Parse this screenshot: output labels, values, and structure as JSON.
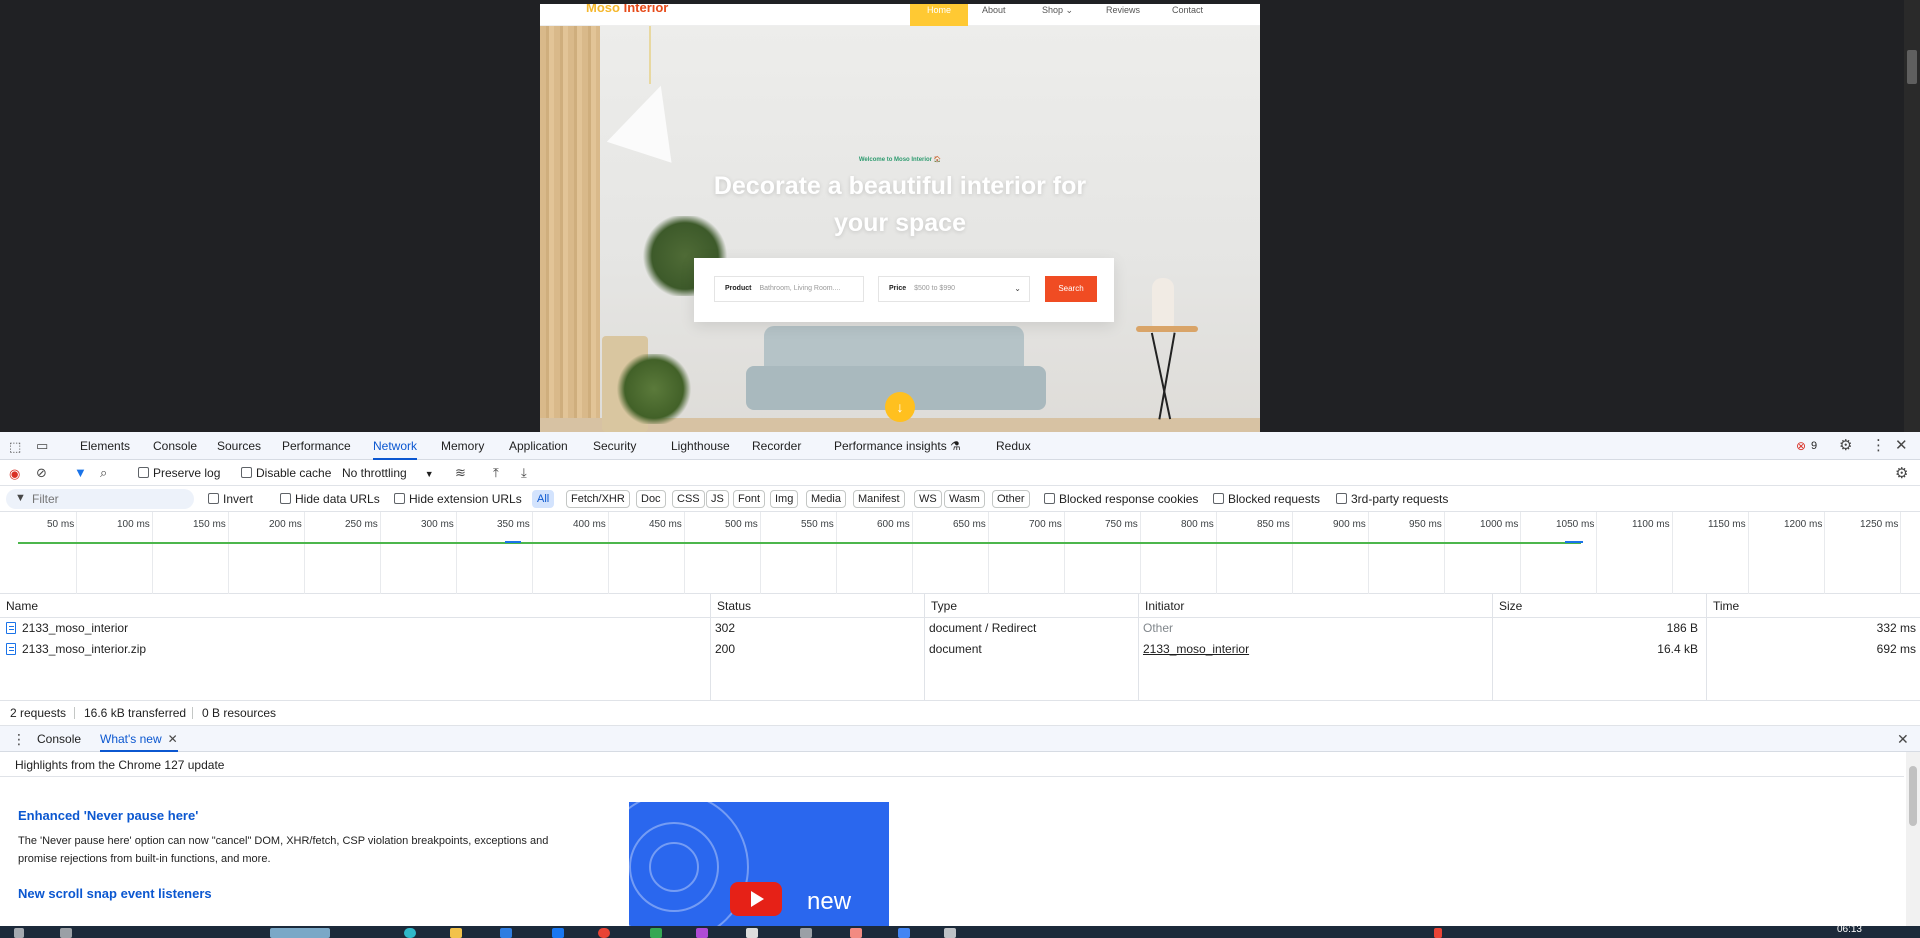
{
  "site": {
    "logo_main": "Moso",
    "logo_accent": "Interior",
    "nav": {
      "home": "Home",
      "about": "About",
      "shop": "Shop ⌄",
      "reviews": "Reviews",
      "contact": "Contact"
    },
    "welcome": "Welcome to Moso Interior 🏠",
    "hero_title": "Decorate a beautiful interior for your space",
    "search": {
      "product_label": "Product",
      "product_value": "Bathroom, Living Room....",
      "price_label": "Price",
      "price_value": "$500 to $990",
      "button": "Search"
    },
    "scroll_icon": "arrow-down-icon"
  },
  "devtools": {
    "tabs": [
      "Elements",
      "Console",
      "Sources",
      "Performance",
      "Network",
      "Memory",
      "Application",
      "Security",
      "Lighthouse",
      "Recorder",
      "Performance insights",
      "Redux"
    ],
    "active_tab": "Network",
    "error_count": "9",
    "toolbar": {
      "preserve_log": "Preserve log",
      "disable_cache": "Disable cache",
      "throttling": "No throttling"
    },
    "filter": {
      "placeholder": "Filter",
      "invert": "Invert",
      "hide_data_urls": "Hide data URLs",
      "hide_extension_urls": "Hide extension URLs",
      "types": [
        "All",
        "Fetch/XHR",
        "Doc",
        "CSS",
        "JS",
        "Font",
        "Img",
        "Media",
        "Manifest",
        "WS",
        "Wasm",
        "Other"
      ],
      "active_type": "All",
      "blocked_response_cookies": "Blocked response cookies",
      "blocked_requests": "Blocked requests",
      "third_party": "3rd-party requests"
    },
    "timeline_ticks": [
      "50 ms",
      "100 ms",
      "150 ms",
      "200 ms",
      "250 ms",
      "300 ms",
      "350 ms",
      "400 ms",
      "450 ms",
      "500 ms",
      "550 ms",
      "600 ms",
      "650 ms",
      "700 ms",
      "750 ms",
      "800 ms",
      "850 ms",
      "900 ms",
      "950 ms",
      "1000 ms",
      "1050 ms",
      "1100 ms",
      "1150 ms",
      "1200 ms",
      "1250 ms"
    ],
    "table": {
      "columns": [
        "Name",
        "Status",
        "Type",
        "Initiator",
        "Size",
        "Time"
      ],
      "rows": [
        {
          "name": "2133_moso_interior",
          "status": "302",
          "type": "document / Redirect",
          "initiator": "Other",
          "size": "186 B",
          "time": "332 ms"
        },
        {
          "name": "2133_moso_interior.zip",
          "status": "200",
          "type": "document",
          "initiator": "2133_moso_interior",
          "size": "16.4 kB",
          "time": "692 ms"
        }
      ]
    },
    "summary": {
      "requests": "2 requests",
      "transferred": "16.6 kB transferred",
      "resources": "0 B resources"
    },
    "drawer": {
      "tabs": [
        "Console",
        "What's new"
      ],
      "active_tab": "What's new",
      "highlights": "Highlights from the Chrome 127 update",
      "item1_title": "Enhanced 'Never pause here'",
      "item1_body": "The 'Never pause here' option can now \"cancel\" DOM, XHR/fetch, CSP violation breakpoints, exceptions and promise rejections from built-in functions, and more.",
      "item2_title": "New scroll snap event listeners",
      "video_word": "new"
    }
  },
  "taskbar": {
    "clock": "06:13"
  },
  "colors": {
    "accent": "#0b57d0",
    "site_yellow": "#ffc933",
    "site_orange": "#f04c23",
    "welcome_green": "#2e9b6f"
  }
}
